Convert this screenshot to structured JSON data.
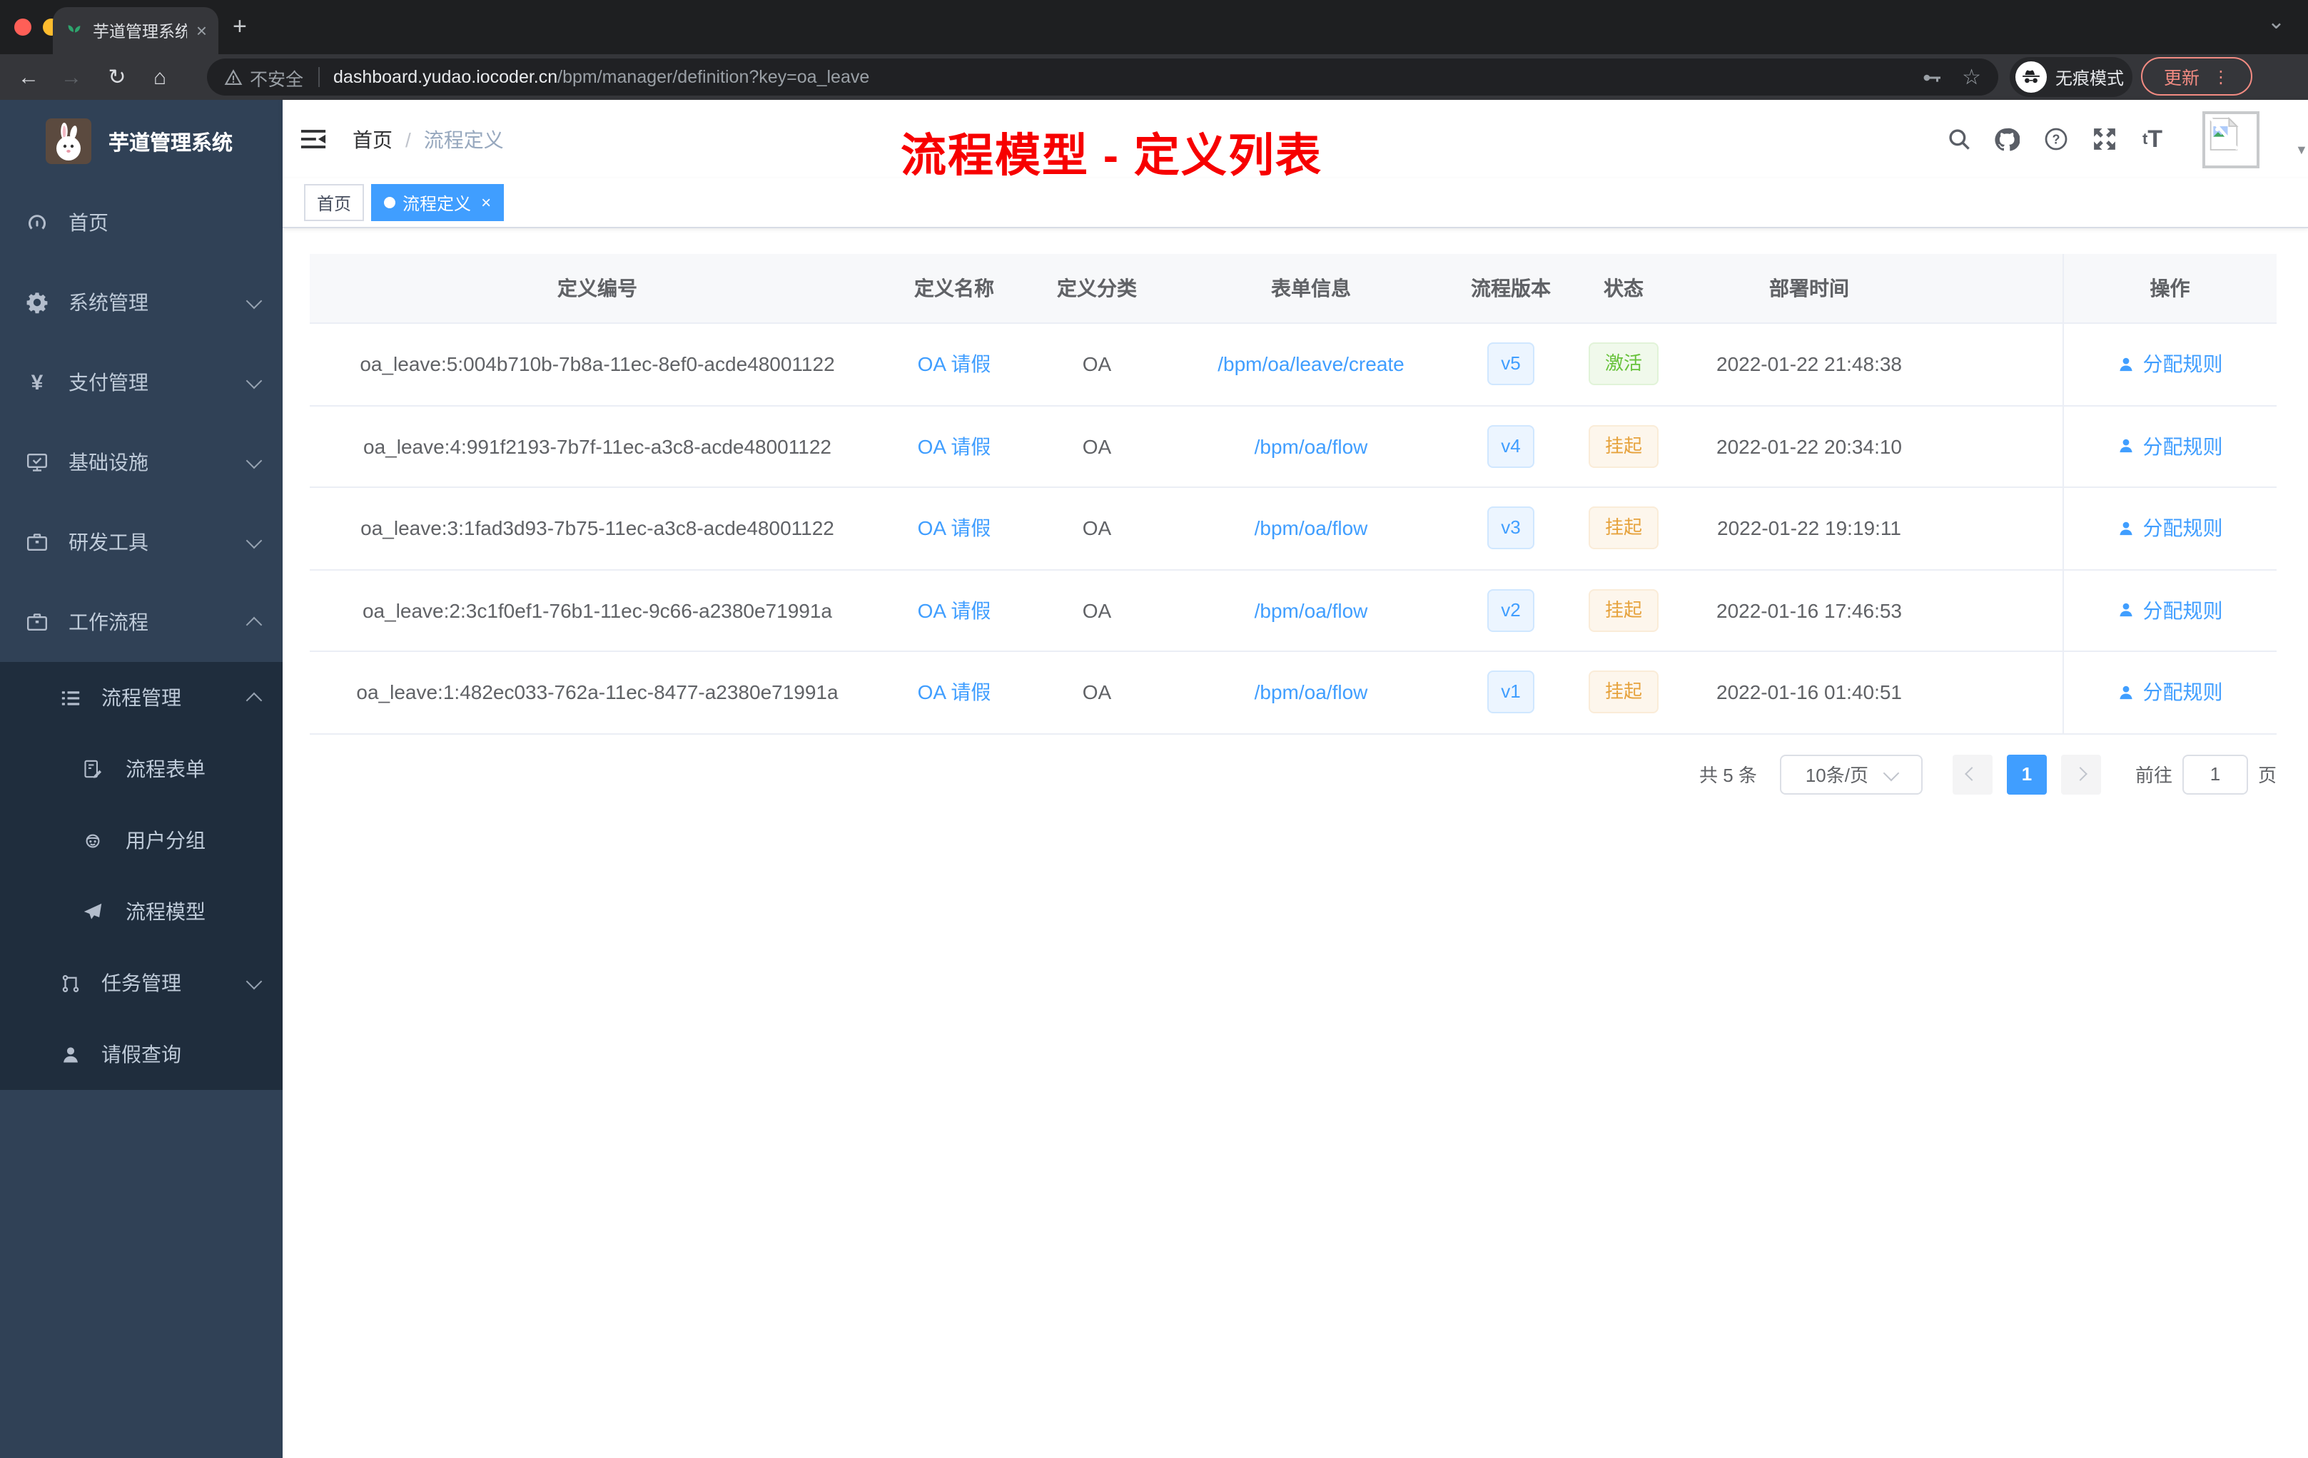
{
  "colors": {
    "primary_blue": "#409eff",
    "success_green": "#67c23a",
    "warning_orange": "#e6a23c",
    "annotation_red": "#f70000",
    "sidebar_bg": "#304156",
    "sidebar_submenu_bg": "#1f2d3d"
  },
  "browser": {
    "tab": {
      "title": "芋道管理系统"
    },
    "security_label": "不安全",
    "url_host": "dashboard.yudao.iocoder.cn",
    "url_path": "/bpm/manager/definition?key=oa_leave",
    "incognito_label": "无痕模式",
    "update_label": "更新"
  },
  "sidebar": {
    "app_title": "芋道管理系统",
    "menu": [
      {
        "label": "首页"
      },
      {
        "label": "系统管理"
      },
      {
        "label": "支付管理"
      },
      {
        "label": "基础设施"
      },
      {
        "label": "研发工具"
      },
      {
        "label": "工作流程"
      }
    ],
    "submenu": [
      {
        "label": "流程管理"
      },
      {
        "label": "流程表单"
      },
      {
        "label": "用户分组"
      },
      {
        "label": "流程模型"
      },
      {
        "label": "任务管理"
      },
      {
        "label": "请假查询"
      }
    ]
  },
  "header": {
    "breadcrumb_home": "首页",
    "breadcrumb_current": "流程定义"
  },
  "annotation": {
    "text": "流程模型 - 定义列表"
  },
  "tags": {
    "home": "首页",
    "active": "流程定义"
  },
  "table": {
    "columns": {
      "id": "定义编号",
      "name": "定义名称",
      "category": "定义分类",
      "form": "表单信息",
      "version": "流程版本",
      "status": "状态",
      "deploy_time": "部署时间",
      "action": "操作"
    },
    "rows": [
      {
        "id": "oa_leave:5:004b710b-7b8a-11ec-8ef0-acde48001122",
        "name": "OA 请假",
        "category": "OA",
        "form": "/bpm/oa/leave/create",
        "version": "v5",
        "status": "激活",
        "deploy_time": "2022-01-22 21:48:38",
        "action": "分配规则"
      },
      {
        "id": "oa_leave:4:991f2193-7b7f-11ec-a3c8-acde48001122",
        "name": "OA 请假",
        "category": "OA",
        "form": "/bpm/oa/flow",
        "version": "v4",
        "status": "挂起",
        "deploy_time": "2022-01-22 20:34:10",
        "action": "分配规则"
      },
      {
        "id": "oa_leave:3:1fad3d93-7b75-11ec-a3c8-acde48001122",
        "name": "OA 请假",
        "category": "OA",
        "form": "/bpm/oa/flow",
        "version": "v3",
        "status": "挂起",
        "deploy_time": "2022-01-22 19:19:11",
        "action": "分配规则"
      },
      {
        "id": "oa_leave:2:3c1f0ef1-76b1-11ec-9c66-a2380e71991a",
        "name": "OA 请假",
        "category": "OA",
        "form": "/bpm/oa/flow",
        "version": "v2",
        "status": "挂起",
        "deploy_time": "2022-01-16 17:46:53",
        "action": "分配规则"
      },
      {
        "id": "oa_leave:1:482ec033-762a-11ec-8477-a2380e71991a",
        "name": "OA 请假",
        "category": "OA",
        "form": "/bpm/oa/flow",
        "version": "v1",
        "status": "挂起",
        "deploy_time": "2022-01-16 01:40:51",
        "action": "分配规则"
      }
    ]
  },
  "pagination": {
    "total": "共 5 条",
    "page_size": "10条/页",
    "page": "1",
    "goto": "前往",
    "goto_value": "1",
    "unit": "页"
  }
}
